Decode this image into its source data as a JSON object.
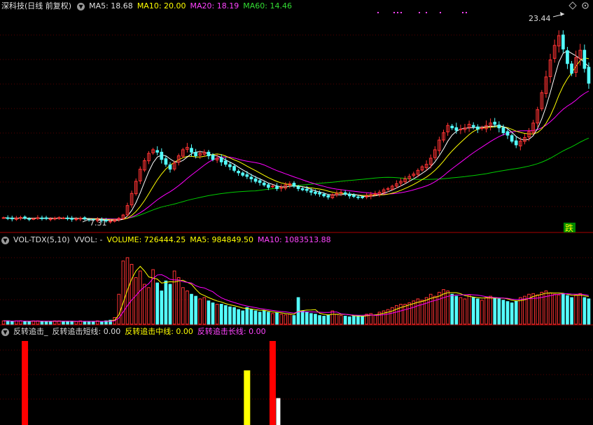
{
  "price_panel": {
    "title": "深科技(日线 前复权)",
    "ma5_label": "MA5: 18.68",
    "ma10_label": "MA10: 20.00",
    "ma20_label": "MA20: 18.19",
    "ma60_label": "MA60: 14.46",
    "high_annotation": "23.44",
    "low_annotation": "7.31",
    "signal_badge": "跌",
    "colors": {
      "ma5": "#ffffff",
      "ma10": "#ffff00",
      "ma20": "#ff00ff",
      "ma60": "#00cc00",
      "up": "#ff3333",
      "down": "#54ffff"
    }
  },
  "volume_panel": {
    "indicator_name": "VOL-TDX(5,10)",
    "vvol_label": "VVOL: -",
    "volume_label": "VOLUME: 726444.25",
    "ma5_label": "MA5: 984849.50",
    "ma10_label": "MA10: 1083513.88"
  },
  "signal_panel": {
    "indicator_name": "反转追击_",
    "short_label": "反转追击短线: 0.00",
    "mid_label": "反转追击中线: 0.00",
    "long_label": "反转追击长线: 0.00"
  },
  "chart_data": {
    "type": "candlestick",
    "price_range": [
      6.5,
      24.5
    ],
    "close": [
      7.6,
      7.55,
      7.5,
      7.58,
      7.62,
      7.55,
      7.48,
      7.52,
      7.6,
      7.57,
      7.53,
      7.5,
      7.56,
      7.61,
      7.58,
      7.52,
      7.47,
      7.5,
      7.55,
      7.49,
      7.44,
      7.4,
      7.45,
      7.38,
      7.33,
      7.31,
      7.4,
      7.55,
      7.82,
      8.6,
      9.6,
      10.6,
      11.6,
      12.3,
      12.9,
      13.2,
      13.0,
      12.4,
      12.0,
      11.6,
      12.1,
      12.7,
      13.2,
      13.4,
      13.0,
      12.7,
      12.9,
      13.0,
      12.7,
      12.4,
      12.5,
      12.2,
      12.0,
      11.8,
      11.5,
      11.3,
      11.1,
      11.0,
      10.8,
      10.6,
      10.5,
      10.3,
      10.1,
      10.2,
      10.0,
      10.1,
      10.3,
      10.4,
      10.2,
      10.0,
      9.9,
      9.85,
      9.7,
      9.6,
      9.55,
      9.4,
      9.3,
      9.5,
      9.6,
      9.7,
      9.55,
      9.4,
      9.35,
      9.3,
      9.25,
      9.4,
      9.5,
      9.6,
      9.7,
      9.9,
      10.0,
      10.2,
      10.4,
      10.6,
      10.8,
      11.0,
      11.2,
      11.5,
      11.8,
      12.0,
      12.5,
      13.2,
      14.0,
      14.6,
      15.2,
      15.0,
      14.8,
      14.9,
      15.0,
      15.3,
      15.1,
      14.9,
      15.0,
      15.2,
      15.4,
      15.3,
      15.0,
      14.6,
      14.4,
      13.9,
      13.6,
      13.9,
      14.2,
      14.7,
      15.4,
      16.5,
      17.9,
      19.2,
      20.6,
      21.8,
      22.6,
      21.5,
      20.3,
      19.5,
      20.8,
      21.4,
      19.9,
      18.68
    ],
    "volume_relative": [
      0.05,
      0.05,
      0.04,
      0.05,
      0.05,
      0.04,
      0.04,
      0.05,
      0.05,
      0.04,
      0.04,
      0.04,
      0.05,
      0.05,
      0.04,
      0.04,
      0.04,
      0.04,
      0.05,
      0.04,
      0.04,
      0.04,
      0.05,
      0.04,
      0.05,
      0.06,
      0.1,
      0.45,
      0.95,
      1.0,
      0.9,
      0.7,
      0.8,
      0.6,
      0.55,
      0.82,
      0.62,
      0.5,
      0.65,
      0.6,
      0.8,
      0.7,
      0.55,
      0.5,
      0.45,
      0.42,
      0.38,
      0.4,
      0.35,
      0.32,
      0.3,
      0.3,
      0.28,
      0.26,
      0.25,
      0.22,
      0.2,
      0.25,
      0.22,
      0.2,
      0.18,
      0.2,
      0.18,
      0.16,
      0.17,
      0.15,
      0.14,
      0.15,
      0.13,
      0.4,
      0.2,
      0.18,
      0.16,
      0.15,
      0.13,
      0.12,
      0.14,
      0.2,
      0.15,
      0.13,
      0.12,
      0.11,
      0.12,
      0.13,
      0.12,
      0.15,
      0.16,
      0.14,
      0.18,
      0.2,
      0.22,
      0.25,
      0.28,
      0.3,
      0.3,
      0.32,
      0.35,
      0.38,
      0.36,
      0.4,
      0.45,
      0.42,
      0.48,
      0.52,
      0.5,
      0.45,
      0.42,
      0.4,
      0.38,
      0.44,
      0.4,
      0.38,
      0.36,
      0.4,
      0.42,
      0.4,
      0.38,
      0.36,
      0.34,
      0.32,
      0.35,
      0.4,
      0.42,
      0.45,
      0.46,
      0.44,
      0.48,
      0.5,
      0.47,
      0.45,
      0.44,
      0.46,
      0.43,
      0.4,
      0.44,
      0.46,
      0.4,
      0.38
    ],
    "signals": [
      {
        "index": 5,
        "kind": "short",
        "value": 1.0
      },
      {
        "index": 57,
        "kind": "mid",
        "value": 0.65
      },
      {
        "index": 63,
        "kind": "short",
        "value": 1.0
      },
      {
        "index": 63,
        "kind": "long",
        "value": 0.32
      }
    ]
  }
}
